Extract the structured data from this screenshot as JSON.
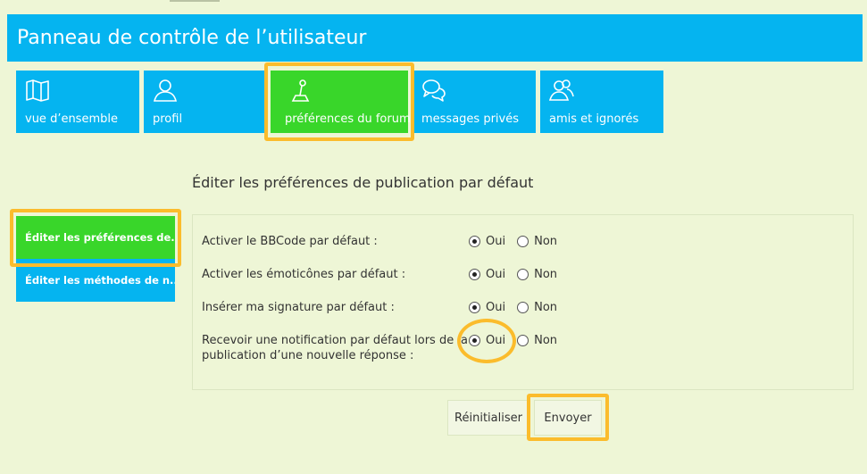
{
  "header": {
    "title": "Panneau de contrôle de l’utilisateur"
  },
  "tabs": [
    {
      "label": "vue d’ensemble",
      "icon": "map-icon"
    },
    {
      "label": "profil",
      "icon": "user-icon"
    },
    {
      "label": "préférences du forum",
      "icon": "joystick-icon",
      "active": true
    },
    {
      "label": "messages privés",
      "icon": "chat-bubbles-icon"
    },
    {
      "label": "amis et ignorés",
      "icon": "users-icon"
    }
  ],
  "section": {
    "title": "Éditer les préférences de publication par défaut"
  },
  "sidebar": {
    "items": [
      {
        "label": "Éditer les préférences de...",
        "active": true
      },
      {
        "label": "Éditer les méthodes de n..."
      }
    ]
  },
  "form": {
    "rows": [
      {
        "label": "Activer le BBCode par défaut :",
        "value": "Oui"
      },
      {
        "label": "Activer les émoticônes par défaut :",
        "value": "Oui"
      },
      {
        "label": "Insérer ma signature par défaut :",
        "value": "Oui"
      },
      {
        "label_line1": "Recevoir une notification par défaut lors de la",
        "label_line2": "publication d’une nouvelle réponse :",
        "value": "Oui"
      }
    ],
    "yes_label": "Oui",
    "no_label": "Non",
    "reset_label": "Réinitialiser",
    "submit_label": "Envoyer"
  },
  "colors": {
    "accent_blue": "#05b4f0",
    "accent_green": "#39d62a",
    "highlight": "#fbbc2c",
    "background": "#eef6d6"
  }
}
